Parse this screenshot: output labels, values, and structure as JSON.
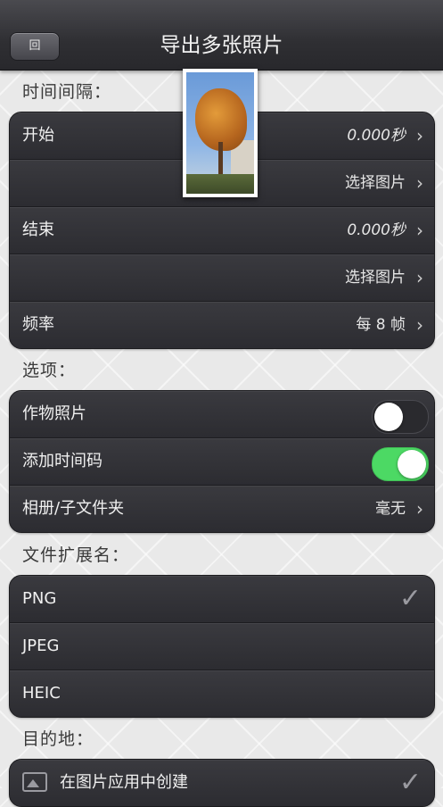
{
  "nav": {
    "back_label": "回",
    "title": "导出多张照片"
  },
  "interval": {
    "label": "时间间隔：",
    "rows": [
      {
        "label": "开始",
        "value": "0.000秒"
      },
      {
        "label": "",
        "value": "选择图片"
      },
      {
        "label": "结束",
        "value": "0.000秒"
      },
      {
        "label": "",
        "value": "选择图片"
      },
      {
        "label": "频率",
        "value": "每 8 帧"
      }
    ]
  },
  "options": {
    "label": "选项：",
    "crop_label": "作物照片",
    "crop_on": false,
    "timecode_label": "添加时间码",
    "timecode_on": true,
    "album_label": "相册/子文件夹",
    "album_value": "毫无"
  },
  "extension": {
    "label": "文件扩展名：",
    "items": [
      "PNG",
      "JPEG",
      "HEIC"
    ],
    "selected": "PNG"
  },
  "destination": {
    "label": "目的地：",
    "items": [
      "在图片应用中创建"
    ]
  },
  "colors": {
    "toggle_on": "#4cd964",
    "navbar": "#2f2f33"
  }
}
